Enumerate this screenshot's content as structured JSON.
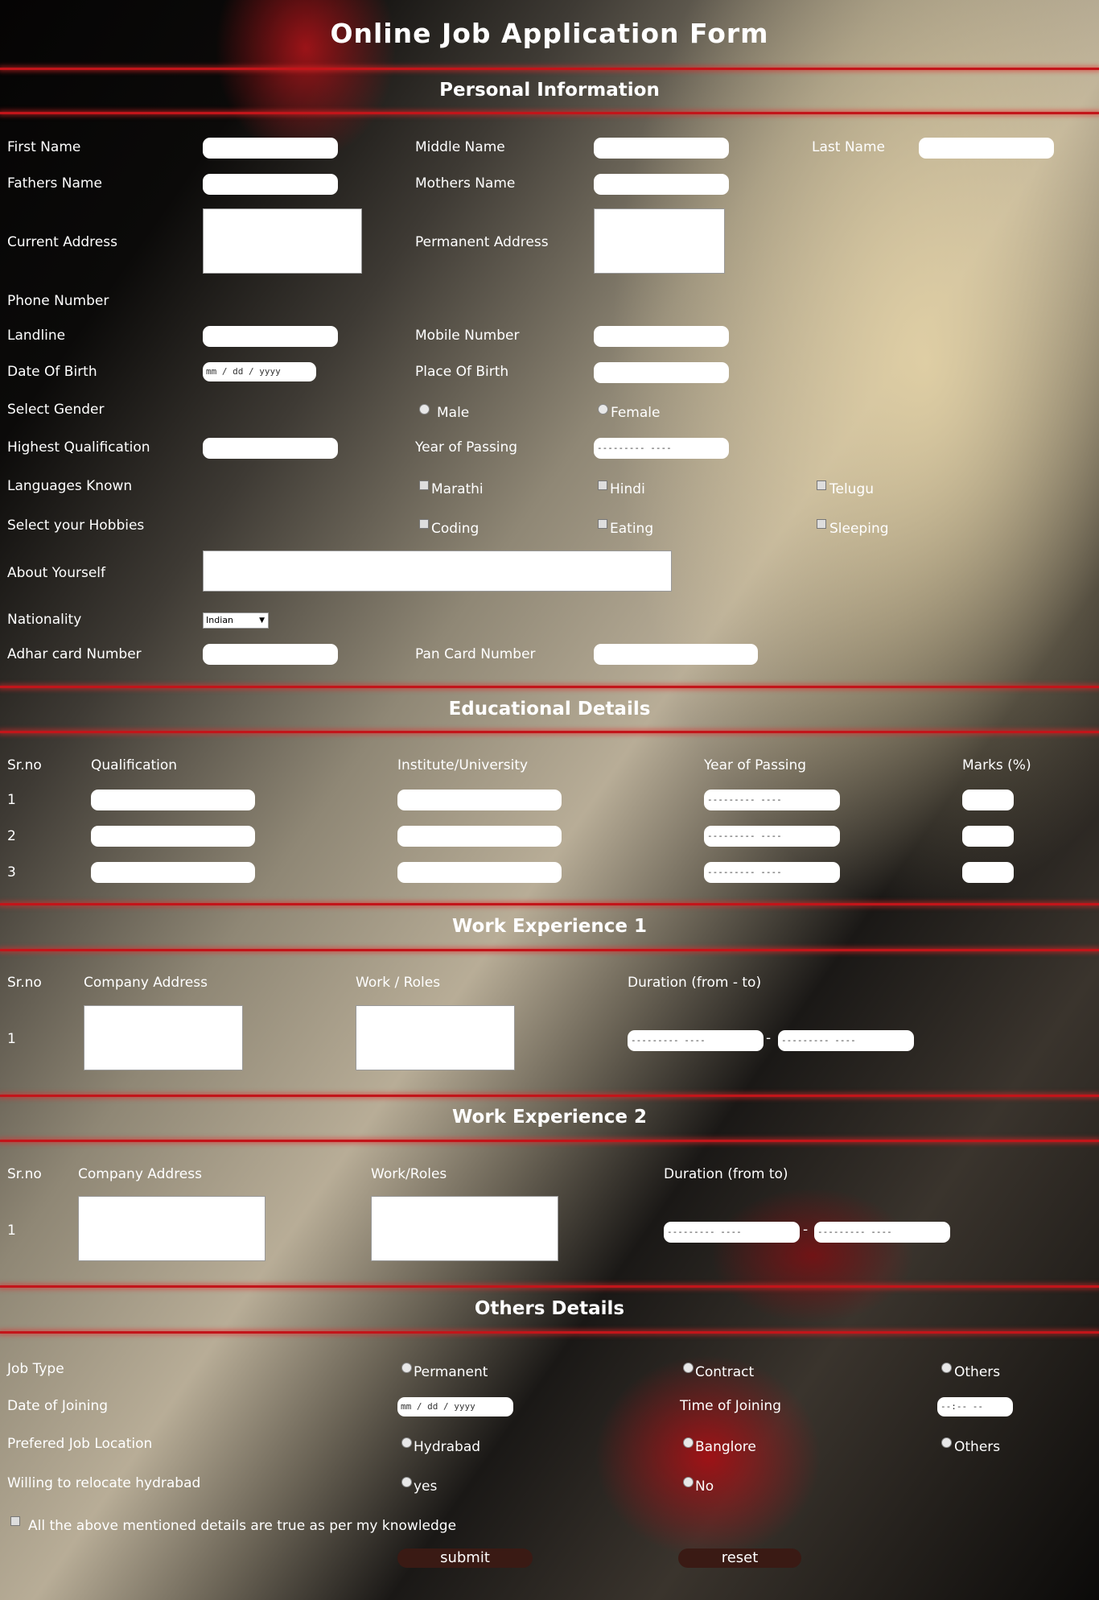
{
  "form_title": "Online Job Application Form",
  "personal": {
    "heading": "Personal Information",
    "first_name": "First Name",
    "middle_name": "Middle Name",
    "last_name": "Last Name",
    "fathers_name": "Fathers Name",
    "mothers_name": "Mothers Name",
    "current_address": "Current Address",
    "permanent_address": "Permanent Address",
    "phone_number": "Phone Number",
    "landline": "Landline",
    "mobile_number": "Mobile Number",
    "date_of_birth": "Date Of Birth",
    "date_placeholder": "mm / dd / yyyy",
    "place_of_birth": "Place Of Birth",
    "select_gender": "Select Gender",
    "gender_options": [
      "Male",
      "Female"
    ],
    "highest_qualification": "Highest Qualification",
    "year_of_passing": "Year of Passing",
    "month_placeholder": "--------- ----",
    "languages_known": "Languages Known",
    "languages": [
      "Marathi",
      "Hindi",
      "Telugu"
    ],
    "select_hobbies": "Select your Hobbies",
    "hobbies": [
      "Coding",
      "Eating",
      "Sleeping"
    ],
    "about_yourself": "About Yourself",
    "nationality": "Nationality",
    "nationality_value": "Indian",
    "adhar_card": "Adhar card Number",
    "pan_card": "Pan Card Number"
  },
  "education": {
    "heading": "Educational Details",
    "columns": [
      "Sr.no",
      "Qualification",
      "Institute/University",
      "Year of Passing",
      "Marks (%)"
    ],
    "rows": [
      "1",
      "2",
      "3"
    ],
    "month_placeholder": "--------- ----"
  },
  "work1": {
    "heading": "Work Experience 1",
    "columns": [
      "Sr.no",
      "Company Address",
      "Work / Roles",
      "Duration (from - to)"
    ],
    "row": "1",
    "separator": "-",
    "month_placeholder": "--------- ----"
  },
  "work2": {
    "heading": "Work Experience 2",
    "columns": [
      "Sr.no",
      "Company Address",
      "Work/Roles",
      "Duration (from to)"
    ],
    "row": "1",
    "separator": "-",
    "month_placeholder": "--------- ----"
  },
  "others": {
    "heading": "Others Details",
    "job_type": "Job Type",
    "job_type_options": [
      "Permanent",
      "Contract",
      "Others"
    ],
    "date_of_joining": "Date of Joining",
    "date_placeholder": "mm / dd / yyyy",
    "time_of_joining": "Time of Joining",
    "time_placeholder": "--:-- --",
    "preferred_location": "Prefered Job Location",
    "location_options": [
      "Hydrabad",
      "Banglore",
      "Others"
    ],
    "relocate": "Willing to relocate hydrabad",
    "relocate_options": [
      "yes",
      "No"
    ],
    "declaration": "All the above mentioned details are true as per my knowledge",
    "submit": "submit",
    "reset": "reset"
  }
}
